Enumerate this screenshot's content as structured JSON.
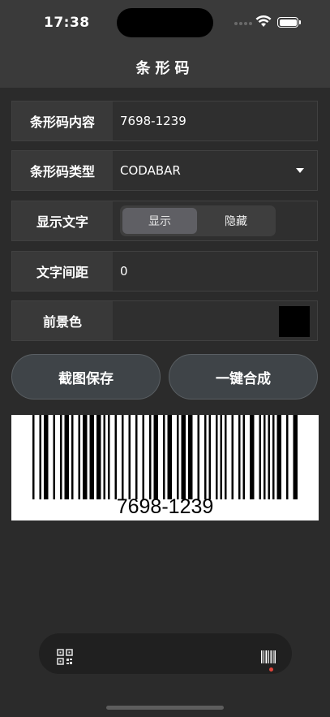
{
  "status_bar": {
    "time": "17:38"
  },
  "nav": {
    "title": "条形码"
  },
  "form": {
    "content": {
      "label": "条形码内容",
      "value": "7698-1239"
    },
    "type": {
      "label": "条形码类型",
      "value": "CODABAR"
    },
    "show_text": {
      "label": "显示文字",
      "options": [
        "显示",
        "隐藏"
      ],
      "selected": "显示"
    },
    "text_spacing": {
      "label": "文字间距",
      "value": "0"
    },
    "foreground": {
      "label": "前景色",
      "color": "#000000"
    }
  },
  "buttons": {
    "screenshot_save": "截图保存",
    "one_click_merge": "一键合成"
  },
  "barcode": {
    "text": "7698-1239",
    "bar_color": "#000000",
    "background": "#ffffff"
  },
  "tab_bar": {
    "tabs": [
      {
        "icon": "qr-code-icon",
        "selected": false
      },
      {
        "icon": "barcode-icon",
        "selected": true
      }
    ],
    "selected_indicator_color": "#e0443a"
  }
}
